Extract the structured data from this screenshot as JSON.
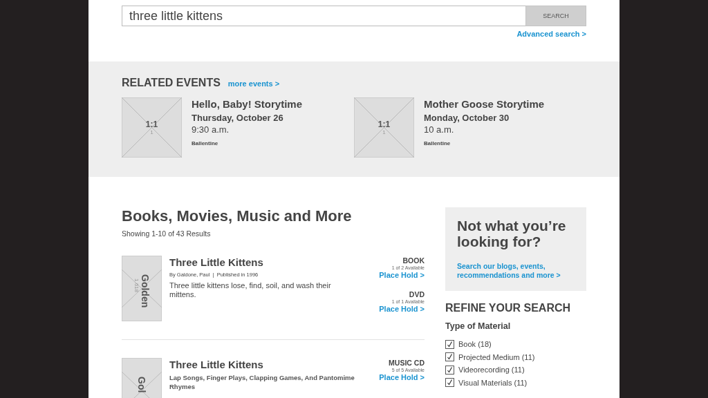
{
  "search": {
    "value": "three little kittens",
    "button": "SEARCH",
    "advanced_link": "Advanced search >"
  },
  "events": {
    "title": "RELATED EVENTS",
    "more_link": "more events >",
    "items": [
      {
        "image": {
          "ratio": "1:1",
          "sub": "1"
        },
        "title": "Hello, Baby! Storytime",
        "date": "Thursday, October 26",
        "time": "9:30 a.m.",
        "location": "Ballentine"
      },
      {
        "image": {
          "ratio": "1:1",
          "sub": "1"
        },
        "title": "Mother Goose Storytime",
        "date": "Monday, October 30",
        "time": "10 a.m.",
        "location": "Ballentine"
      }
    ]
  },
  "results": {
    "title": "Books, Movies, Music and More",
    "count": "Showing 1-10 of 43 Results",
    "items": [
      {
        "cover": {
          "label": "Golden",
          "sub": "1.618"
        },
        "title": "Three Little Kittens",
        "meta": "By Galdone, Paul  |  Published in 1996",
        "description": "Three little kittens lose, find, soil, and wash their mittens.",
        "formats": [
          {
            "type": "BOOK",
            "availability": "1 of 2 Available",
            "action": "Place Hold >"
          },
          {
            "type": "DVD",
            "availability": "1 of 1 Available",
            "action": "Place Hold >"
          }
        ]
      },
      {
        "cover": {
          "label": "Gol"
        },
        "title": "Three Little Kittens",
        "subtitle": "Lap Songs, Finger Plays, Clapping Games, And Pantomime Rhymes",
        "formats": [
          {
            "type": "MUSIC CD",
            "availability": "5 of 5 Available",
            "action": "Place Hold >"
          }
        ]
      }
    ]
  },
  "sidebar": {
    "promo": {
      "title": "Not what you’re looking for?",
      "link": "Search our blogs, events, recommendations and more >"
    },
    "refine_title": "REFINE YOUR SEARCH",
    "facet": {
      "title": "Type of Material",
      "options": [
        {
          "label": "Book (18)",
          "checked": true
        },
        {
          "label": "Projected Medium (11)",
          "checked": true
        },
        {
          "label": "Videorecording (11)",
          "checked": true
        },
        {
          "label": "Visual Materials (11)",
          "checked": true
        }
      ]
    }
  }
}
